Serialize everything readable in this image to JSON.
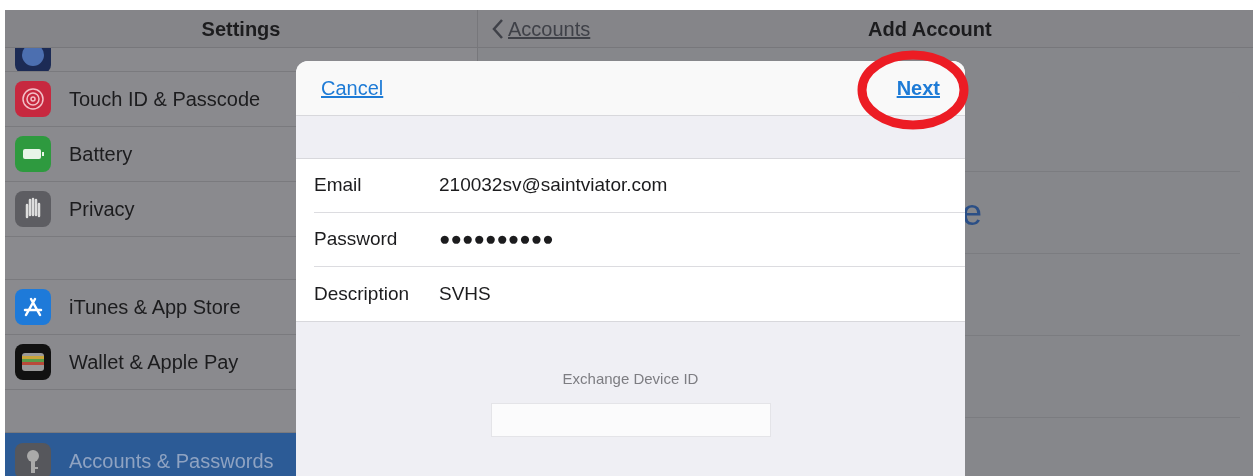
{
  "sidebar": {
    "title": "Settings",
    "items": [
      {
        "kind": "cut"
      },
      {
        "kind": "row",
        "label": "Touch ID & Passcode",
        "selected": false
      },
      {
        "kind": "row",
        "label": "Battery",
        "selected": false
      },
      {
        "kind": "row",
        "label": "Privacy",
        "selected": false
      },
      {
        "kind": "gap"
      },
      {
        "kind": "row",
        "label": "iTunes & App Store",
        "selected": false
      },
      {
        "kind": "row",
        "label": "Wallet & Apple Pay",
        "selected": false
      },
      {
        "kind": "gap"
      },
      {
        "kind": "row",
        "label": "Accounts & Passwords",
        "selected": true
      }
    ]
  },
  "detail": {
    "back": "Accounts",
    "title": "Add Account",
    "peek_letter": "e"
  },
  "dialog": {
    "cancel": "Cancel",
    "next": "Next",
    "fields": [
      {
        "label": "Email",
        "value": "210032sv@saintviator.com"
      },
      {
        "label": "Password",
        "value": "●●●●●●●●●●"
      },
      {
        "label": "Description",
        "value": "SVHS"
      }
    ],
    "footer": "Exchange Device ID"
  }
}
